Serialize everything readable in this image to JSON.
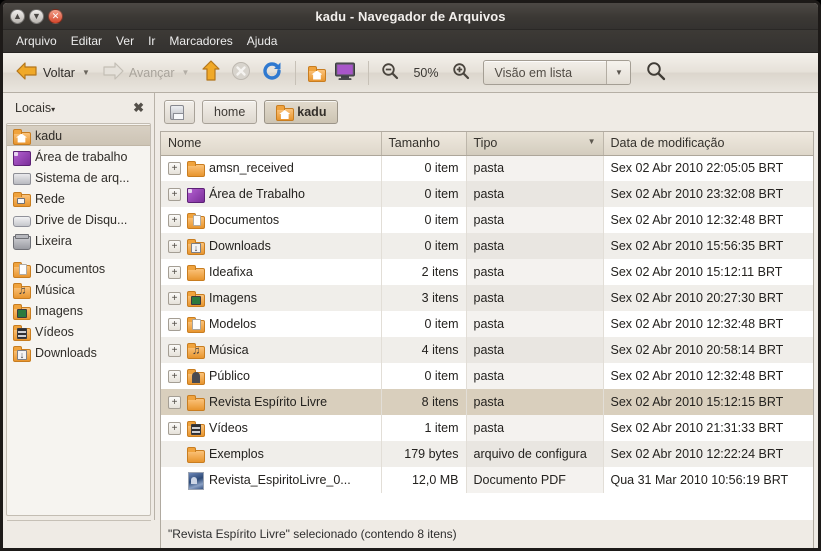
{
  "window": {
    "title": "kadu - Navegador de Arquivos",
    "buttons": {
      "minimize": "minimize-icon",
      "maximize": "maximize-icon",
      "close": "close-icon"
    }
  },
  "menubar": {
    "items": [
      "Arquivo",
      "Editar",
      "Ver",
      "Ir",
      "Marcadores",
      "Ajuda"
    ]
  },
  "toolbar": {
    "back_label": "Voltar",
    "forward_label": "Avançar",
    "up_label": "up-arrow",
    "stop_label": "stop",
    "reload_label": "reload",
    "home_label": "home",
    "computer_label": "computer",
    "zoom_out_label": "zoom-out",
    "zoom_level": "50%",
    "zoom_in_label": "zoom-in",
    "view_mode": "Visão em lista",
    "search_label": "search"
  },
  "sidebar": {
    "header": "Locais",
    "header_caret": "▾",
    "close_label": "✖",
    "groups": [
      {
        "items": [
          {
            "label": "kadu",
            "icon": "home-folder-icon",
            "selected": true
          },
          {
            "label": "Área de trabalho",
            "icon": "desktop-icon",
            "selected": false
          },
          {
            "label": "Sistema de arq...",
            "icon": "drive-icon",
            "selected": false
          },
          {
            "label": "Rede",
            "icon": "network-icon",
            "selected": false
          },
          {
            "label": "Drive de Disqu...",
            "icon": "cdrom-icon",
            "selected": false
          },
          {
            "label": "Lixeira",
            "icon": "trash-icon",
            "selected": false
          }
        ]
      },
      {
        "items": [
          {
            "label": "Documentos",
            "icon": "documents-folder-icon",
            "selected": false
          },
          {
            "label": "Música",
            "icon": "music-folder-icon",
            "selected": false
          },
          {
            "label": "Imagens",
            "icon": "pictures-folder-icon",
            "selected": false
          },
          {
            "label": "Vídeos",
            "icon": "videos-folder-icon",
            "selected": false
          },
          {
            "label": "Downloads",
            "icon": "downloads-folder-icon",
            "selected": false
          }
        ]
      }
    ]
  },
  "breadcrumb": {
    "items": [
      {
        "label": "",
        "icon": "disk-icon",
        "active": false
      },
      {
        "label": "home",
        "icon": "",
        "active": false
      },
      {
        "label": "kadu",
        "icon": "home-folder-icon",
        "active": true
      }
    ]
  },
  "file_list": {
    "columns": [
      {
        "label": "Nome",
        "sorted": false
      },
      {
        "label": "Tamanho",
        "sorted": false
      },
      {
        "label": "Tipo",
        "sorted": true,
        "sort_arrow": "▼"
      },
      {
        "label": "Data de modificação",
        "sorted": false
      }
    ],
    "rows": [
      {
        "expander": "+",
        "icon": "folder-icon",
        "name": "amsn_received",
        "size": "0 item",
        "type": "pasta",
        "date": "Sex 02 Abr 2010 22:05:05 BRT",
        "selected": false
      },
      {
        "expander": "+",
        "icon": "desktop-icon",
        "name": "Área de Trabalho",
        "size": "0 item",
        "type": "pasta",
        "date": "Sex 02 Abr 2010 23:32:08 BRT",
        "selected": false
      },
      {
        "expander": "+",
        "icon": "documents-folder-icon",
        "name": "Documentos",
        "size": "0 item",
        "type": "pasta",
        "date": "Sex 02 Abr 2010 12:32:48 BRT",
        "selected": false
      },
      {
        "expander": "+",
        "icon": "downloads-folder-icon",
        "name": "Downloads",
        "size": "0 item",
        "type": "pasta",
        "date": "Sex 02 Abr 2010 15:56:35 BRT",
        "selected": false
      },
      {
        "expander": "+",
        "icon": "folder-icon",
        "name": "Ideafixa",
        "size": "2 itens",
        "type": "pasta",
        "date": "Sex 02 Abr 2010 15:12:11 BRT",
        "selected": false
      },
      {
        "expander": "+",
        "icon": "pictures-folder-icon",
        "name": "Imagens",
        "size": "3 itens",
        "type": "pasta",
        "date": "Sex 02 Abr 2010 20:27:30 BRT",
        "selected": false
      },
      {
        "expander": "+",
        "icon": "templates-folder-icon",
        "name": "Modelos",
        "size": "0 item",
        "type": "pasta",
        "date": "Sex 02 Abr 2010 12:32:48 BRT",
        "selected": false
      },
      {
        "expander": "+",
        "icon": "music-folder-icon",
        "name": "Música",
        "size": "4 itens",
        "type": "pasta",
        "date": "Sex 02 Abr 2010 20:58:14 BRT",
        "selected": false
      },
      {
        "expander": "+",
        "icon": "public-folder-icon",
        "name": "Público",
        "size": "0 item",
        "type": "pasta",
        "date": "Sex 02 Abr 2010 12:32:48 BRT",
        "selected": false
      },
      {
        "expander": "+",
        "icon": "folder-icon",
        "name": "Revista Espírito Livre",
        "size": "8 itens",
        "type": "pasta",
        "date": "Sex 02 Abr 2010 15:12:15 BRT",
        "selected": true
      },
      {
        "expander": "+",
        "icon": "videos-folder-icon",
        "name": "Vídeos",
        "size": "1 item",
        "type": "pasta",
        "date": "Sex 02 Abr 2010 21:31:33 BRT",
        "selected": false
      },
      {
        "expander": "",
        "icon": "folder-icon",
        "name": "Exemplos",
        "size": "179 bytes",
        "type": "arquivo de configura",
        "date": "Sex 02 Abr 2010 12:22:24 BRT",
        "selected": false
      },
      {
        "expander": "",
        "icon": "pdf-icon",
        "name": "Revista_EspiritoLivre_0...",
        "size": "12,0 MB",
        "type": "Documento PDF",
        "date": "Qua 31 Mar 2010 10:56:19 BRT",
        "selected": false
      }
    ]
  },
  "statusbar": {
    "text": "\"Revista Espírito Livre\" selecionado (contendo 8 itens)"
  },
  "colors": {
    "titlebar": "#3b3834",
    "chrome": "#efebe5",
    "selection": "#d9cfbd",
    "folder_orange": "#e8952e"
  }
}
